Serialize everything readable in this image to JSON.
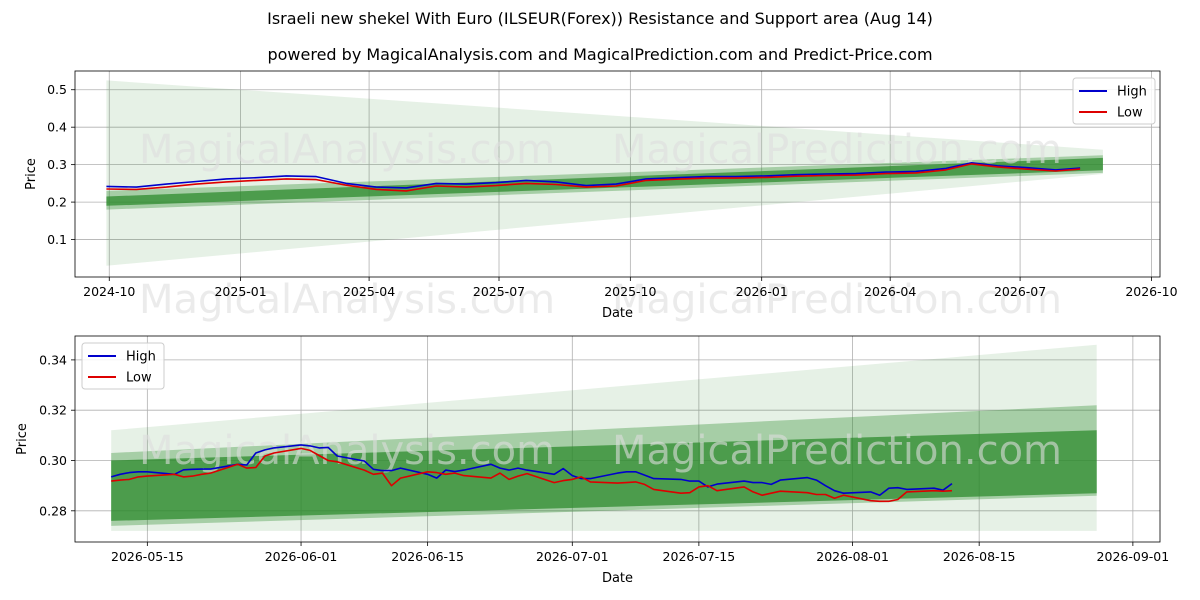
{
  "title": "Israeli new shekel With Euro (ILSEUR(Forex)) Resistance and Support area (Aug 14)",
  "subtitle": "powered by MagicalAnalysis.com and MagicalPrediction.com and Predict-Price.com",
  "watermarks": [
    "MagicalAnalysis.com",
    "MagicalPrediction.com"
  ],
  "colors": {
    "high": "#0000cc",
    "low": "#dd0000",
    "band": "#2e8b2e",
    "grid": "#b0b0b0",
    "watermark": "#dddddd"
  },
  "chart_data": [
    {
      "type": "line",
      "xlabel": "Date",
      "ylabel": "Price",
      "grid": true,
      "legend_position": "top-right",
      "xlim": [
        "2024-09-07",
        "2026-10-07"
      ],
      "ylim": [
        0.0,
        0.55
      ],
      "xticks": [
        "2024-10",
        "2025-01",
        "2025-04",
        "2025-07",
        "2025-10",
        "2026-01",
        "2026-04",
        "2026-07",
        "2026-10"
      ],
      "yticks": [
        "0.1",
        "0.2",
        "0.3",
        "0.4",
        "0.5"
      ],
      "ytick_values": [
        0.1,
        0.2,
        0.3,
        0.4,
        0.5
      ],
      "band": {
        "x": [
          "2024-09-29",
          "2026-08-28"
        ],
        "core_low": [
          0.19,
          0.285
        ],
        "core_high": [
          0.215,
          0.318
        ],
        "mid_low": [
          0.18,
          0.278
        ],
        "mid_high": [
          0.23,
          0.325
        ],
        "outer_low": [
          0.03,
          0.275
        ],
        "outer_high": [
          0.525,
          0.34
        ]
      },
      "series": [
        {
          "name": "High",
          "x": [
            "2024-09-29",
            "2024-10-20",
            "2024-11-10",
            "2024-12-01",
            "2024-12-22",
            "2025-01-12",
            "2025-02-02",
            "2025-02-23",
            "2025-03-16",
            "2025-04-06",
            "2025-04-27",
            "2025-05-18",
            "2025-06-08",
            "2025-06-29",
            "2025-07-20",
            "2025-08-10",
            "2025-08-31",
            "2025-09-21",
            "2025-10-12",
            "2025-11-02",
            "2025-11-23",
            "2025-12-14",
            "2026-01-04",
            "2026-01-25",
            "2026-02-15",
            "2026-03-08",
            "2026-03-29",
            "2026-04-19",
            "2026-05-10",
            "2026-05-28",
            "2026-06-15",
            "2026-07-05",
            "2026-07-26",
            "2026-08-12"
          ],
          "values": [
            0.242,
            0.24,
            0.248,
            0.255,
            0.262,
            0.265,
            0.27,
            0.268,
            0.25,
            0.24,
            0.238,
            0.25,
            0.248,
            0.252,
            0.258,
            0.254,
            0.244,
            0.248,
            0.262,
            0.265,
            0.268,
            0.268,
            0.27,
            0.273,
            0.275,
            0.276,
            0.28,
            0.282,
            0.29,
            0.305,
            0.297,
            0.292,
            0.286,
            0.291
          ]
        },
        {
          "name": "Low",
          "x": [
            "2024-09-29",
            "2024-10-20",
            "2024-11-10",
            "2024-12-01",
            "2024-12-22",
            "2025-01-12",
            "2025-02-02",
            "2025-02-23",
            "2025-03-16",
            "2025-04-06",
            "2025-04-27",
            "2025-05-18",
            "2025-06-08",
            "2025-06-29",
            "2025-07-20",
            "2025-08-10",
            "2025-08-31",
            "2025-09-21",
            "2025-10-12",
            "2025-11-02",
            "2025-11-23",
            "2025-12-14",
            "2026-01-04",
            "2026-01-25",
            "2026-02-15",
            "2026-03-08",
            "2026-03-29",
            "2026-04-19",
            "2026-05-10",
            "2026-05-28",
            "2026-06-15",
            "2026-07-05",
            "2026-07-26",
            "2026-08-12"
          ],
          "values": [
            0.235,
            0.234,
            0.24,
            0.248,
            0.254,
            0.258,
            0.262,
            0.26,
            0.245,
            0.234,
            0.23,
            0.243,
            0.24,
            0.244,
            0.25,
            0.247,
            0.24,
            0.243,
            0.258,
            0.261,
            0.264,
            0.264,
            0.266,
            0.269,
            0.271,
            0.272,
            0.276,
            0.278,
            0.286,
            0.302,
            0.294,
            0.288,
            0.283,
            0.288
          ]
        }
      ]
    },
    {
      "type": "line",
      "xlabel": "Date",
      "ylabel": "Price",
      "grid": true,
      "legend_position": "top-left",
      "xlim": [
        "2026-05-07",
        "2026-09-04"
      ],
      "ylim": [
        0.2676,
        0.3495
      ],
      "xticks": [
        "2026-05-15",
        "2026-06-01",
        "2026-06-15",
        "2026-07-01",
        "2026-07-15",
        "2026-08-01",
        "2026-08-15",
        "2026-09-01"
      ],
      "yticks": [
        "0.28",
        "0.30",
        "0.32",
        "0.34"
      ],
      "ytick_values": [
        0.28,
        0.3,
        0.32,
        0.34
      ],
      "band": {
        "x": [
          "2026-05-11",
          "2026-08-28"
        ],
        "core_low": [
          0.276,
          0.287
        ],
        "core_high": [
          0.3,
          0.312
        ],
        "mid_low": [
          0.274,
          0.286
        ],
        "mid_high": [
          0.303,
          0.322
        ],
        "outer_low": [
          0.272,
          0.272
        ],
        "outer_high": [
          0.312,
          0.346
        ]
      },
      "series": [
        {
          "name": "High",
          "x": [
            "2026-05-11",
            "2026-05-12",
            "2026-05-13",
            "2026-05-14",
            "2026-05-15",
            "2026-05-18",
            "2026-05-19",
            "2026-05-20",
            "2026-05-21",
            "2026-05-22",
            "2026-05-25",
            "2026-05-26",
            "2026-05-27",
            "2026-05-28",
            "2026-05-29",
            "2026-06-01",
            "2026-06-02",
            "2026-06-03",
            "2026-06-04",
            "2026-06-05",
            "2026-06-08",
            "2026-06-09",
            "2026-06-10",
            "2026-06-11",
            "2026-06-12",
            "2026-06-15",
            "2026-06-16",
            "2026-06-17",
            "2026-06-18",
            "2026-06-19",
            "2026-06-22",
            "2026-06-23",
            "2026-06-24",
            "2026-06-25",
            "2026-06-26",
            "2026-06-29",
            "2026-06-30",
            "2026-07-01",
            "2026-07-02",
            "2026-07-03",
            "2026-07-06",
            "2026-07-07",
            "2026-07-08",
            "2026-07-09",
            "2026-07-10",
            "2026-07-13",
            "2026-07-14",
            "2026-07-15",
            "2026-07-16",
            "2026-07-17",
            "2026-07-20",
            "2026-07-21",
            "2026-07-22",
            "2026-07-23",
            "2026-07-24",
            "2026-07-27",
            "2026-07-28",
            "2026-07-29",
            "2026-07-30",
            "2026-07-31",
            "2026-08-03",
            "2026-08-04",
            "2026-08-05",
            "2026-08-06",
            "2026-08-07",
            "2026-08-10",
            "2026-08-11",
            "2026-08-12"
          ],
          "values": [
            0.2935,
            0.2945,
            0.2952,
            0.2955,
            0.2955,
            0.2945,
            0.2963,
            0.2965,
            0.2966,
            0.2966,
            0.2985,
            0.2982,
            0.303,
            0.3042,
            0.305,
            0.3062,
            0.3058,
            0.305,
            0.3052,
            0.3018,
            0.2998,
            0.2965,
            0.296,
            0.296,
            0.297,
            0.2945,
            0.293,
            0.2962,
            0.2956,
            0.2962,
            0.2985,
            0.297,
            0.2962,
            0.297,
            0.2962,
            0.2945,
            0.2968,
            0.294,
            0.2928,
            0.2928,
            0.295,
            0.2955,
            0.2955,
            0.2942,
            0.2928,
            0.2925,
            0.2918,
            0.2918,
            0.2895,
            0.2906,
            0.2918,
            0.2912,
            0.2912,
            0.2905,
            0.2922,
            0.2932,
            0.2922,
            0.29,
            0.288,
            0.287,
            0.2875,
            0.2862,
            0.289,
            0.2892,
            0.2885,
            0.289,
            0.2882,
            0.2908
          ]
        },
        {
          "name": "Low",
          "x": [
            "2026-05-11",
            "2026-05-12",
            "2026-05-13",
            "2026-05-14",
            "2026-05-15",
            "2026-05-18",
            "2026-05-19",
            "2026-05-20",
            "2026-05-21",
            "2026-05-22",
            "2026-05-25",
            "2026-05-26",
            "2026-05-27",
            "2026-05-28",
            "2026-05-29",
            "2026-06-01",
            "2026-06-02",
            "2026-06-03",
            "2026-06-04",
            "2026-06-05",
            "2026-06-08",
            "2026-06-09",
            "2026-06-10",
            "2026-06-11",
            "2026-06-12",
            "2026-06-15",
            "2026-06-16",
            "2026-06-17",
            "2026-06-18",
            "2026-06-19",
            "2026-06-22",
            "2026-06-23",
            "2026-06-24",
            "2026-06-25",
            "2026-06-26",
            "2026-06-29",
            "2026-06-30",
            "2026-07-01",
            "2026-07-02",
            "2026-07-03",
            "2026-07-06",
            "2026-07-07",
            "2026-07-08",
            "2026-07-09",
            "2026-07-10",
            "2026-07-13",
            "2026-07-14",
            "2026-07-15",
            "2026-07-16",
            "2026-07-17",
            "2026-07-20",
            "2026-07-21",
            "2026-07-22",
            "2026-07-23",
            "2026-07-24",
            "2026-07-27",
            "2026-07-28",
            "2026-07-29",
            "2026-07-30",
            "2026-07-31",
            "2026-08-03",
            "2026-08-04",
            "2026-08-05",
            "2026-08-06",
            "2026-08-07",
            "2026-08-10",
            "2026-08-11",
            "2026-08-12"
          ],
          "values": [
            0.2918,
            0.2922,
            0.2925,
            0.2935,
            0.2938,
            0.2945,
            0.2935,
            0.2938,
            0.2945,
            0.295,
            0.2985,
            0.297,
            0.2972,
            0.3018,
            0.303,
            0.3048,
            0.304,
            0.302,
            0.3,
            0.2995,
            0.2962,
            0.2945,
            0.295,
            0.29,
            0.293,
            0.2955,
            0.2952,
            0.2945,
            0.295,
            0.294,
            0.293,
            0.295,
            0.2925,
            0.2938,
            0.2948,
            0.2912,
            0.292,
            0.2925,
            0.2935,
            0.2915,
            0.291,
            0.2912,
            0.2915,
            0.2905,
            0.2885,
            0.287,
            0.2872,
            0.2895,
            0.29,
            0.288,
            0.2895,
            0.2875,
            0.2862,
            0.287,
            0.2878,
            0.2872,
            0.2865,
            0.2865,
            0.285,
            0.2862,
            0.284,
            0.2838,
            0.2838,
            0.2845,
            0.2875,
            0.288,
            0.2878,
            0.288
          ]
        }
      ]
    }
  ]
}
